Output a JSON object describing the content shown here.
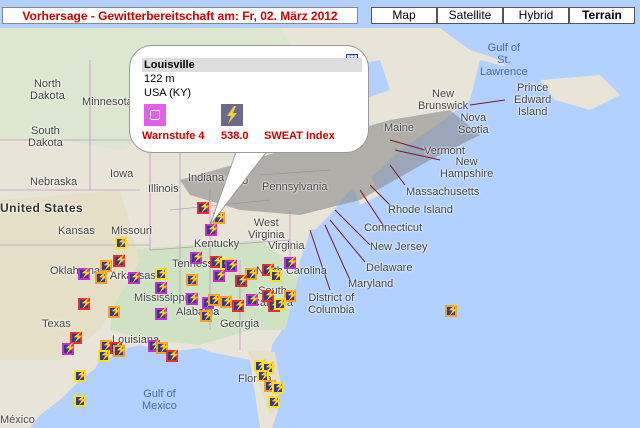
{
  "header": {
    "title": "Vorhersage - Gewitterbereitschaft am: Fr, 02. März 2012",
    "map_types": [
      "Map",
      "Satellite",
      "Hybrid",
      "Terrain"
    ],
    "active_map_type": "Terrain"
  },
  "popup": {
    "city": "Louisville",
    "elevation": "122 m",
    "region": "USA (KY)",
    "close_symbol": "☒",
    "warning_label": "Warnstufe 4",
    "sweat_value": "538.0",
    "sweat_label": "SWEAT Index"
  },
  "labels": {
    "north_dakota": "North",
    "north_dakota_2": "Dakota",
    "south_dakota": "South",
    "south_dakota_2": "Dakota",
    "minnesota": "Minnesota",
    "nebraska": "Nebraska",
    "iowa": "Iowa",
    "illinois": "Illinois",
    "indiana": "Indiana",
    "ohio": "Ohio",
    "pennsylvania": "Pennsylvania",
    "west_virginia": "West",
    "west_virginia_2": "Virginia",
    "virginia": "Virginia",
    "kentucky": "Kentucky",
    "tennessee": "Tennessee",
    "missouri": "Missouri",
    "kansas": "Kansas",
    "oklahoma": "Oklahoma",
    "arkansas": "Arkansas",
    "mississippi": "Mississippi",
    "alabama": "Alabama",
    "georgia": "Georgia",
    "texas": "Texas",
    "louisiana": "Louisiana",
    "north_carolina": "North Carolina",
    "south_carolina": "South",
    "south_carolina_2": "Carolina",
    "florida": "Florida",
    "united_states": "United States",
    "mexico": "México",
    "maine": "Maine",
    "vermont": "Vermont",
    "new_hampshire": "New",
    "new_hampshire_2": "Hampshire",
    "massachusetts": "Massachusetts",
    "rhode_island": "Rhode Island",
    "connecticut": "Connecticut",
    "new_jersey": "New Jersey",
    "delaware": "Delaware",
    "maryland": "Maryland",
    "dc": "District of",
    "dc_2": "Columbia",
    "new_brunswick": "New",
    "new_brunswick_2": "Brunswick",
    "nova_scotia": "Nova",
    "nova_scotia_2": "Scotia",
    "pei": "Prince",
    "pei_2": "Edward",
    "pei_3": "Island",
    "gulf_st_lawrence": "Gulf of",
    "gulf_st_lawrence_2": "St.",
    "gulf_st_lawrence_3": "Lawrence",
    "gulf_mexico": "Gulf of",
    "gulf_mexico_2": "Mexico"
  },
  "markers": {
    "glyph": "⚡",
    "count": 64
  }
}
